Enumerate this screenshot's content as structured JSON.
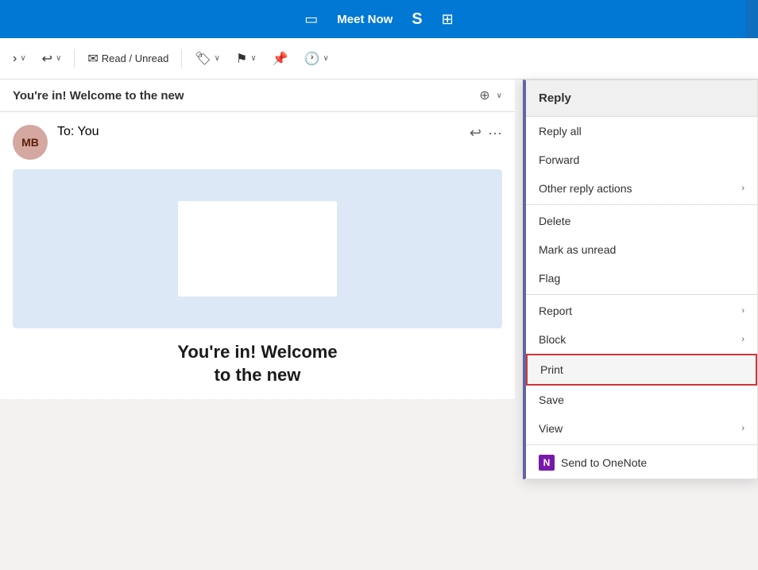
{
  "topbar": {
    "meet_now_label": "Meet Now",
    "skype_symbol": "S"
  },
  "toolbar": {
    "back_icon": "←",
    "read_unread_label": "Read / Unread",
    "tag_label": "",
    "flag_label": "",
    "pin_label": "",
    "clock_label": ""
  },
  "email_header": {
    "subject": "You're in! Welcome to the new",
    "zoom_icon": "⊕"
  },
  "email": {
    "sender_initials": "MB",
    "to_label": "To:  You",
    "reply_icon": "↩",
    "more_icon": "···",
    "headline_line1": "You're in! Welcome",
    "headline_line2": "to the new"
  },
  "dropdown": {
    "items": [
      {
        "id": "reply",
        "label": "Reply",
        "has_arrow": false,
        "highlighted": false
      },
      {
        "id": "reply-all",
        "label": "Reply all",
        "has_arrow": false,
        "highlighted": false
      },
      {
        "id": "forward",
        "label": "Forward",
        "has_arrow": false,
        "highlighted": false
      },
      {
        "id": "other-reply",
        "label": "Other reply actions",
        "has_arrow": true,
        "highlighted": false
      },
      {
        "id": "delete",
        "label": "Delete",
        "has_arrow": false,
        "highlighted": false
      },
      {
        "id": "mark-unread",
        "label": "Mark as unread",
        "has_arrow": false,
        "highlighted": false
      },
      {
        "id": "flag",
        "label": "Flag",
        "has_arrow": false,
        "highlighted": false
      },
      {
        "id": "report",
        "label": "Report",
        "has_arrow": true,
        "highlighted": false
      },
      {
        "id": "block",
        "label": "Block",
        "has_arrow": true,
        "highlighted": false
      },
      {
        "id": "print",
        "label": "Print",
        "has_arrow": false,
        "highlighted": true
      },
      {
        "id": "save",
        "label": "Save",
        "has_arrow": false,
        "highlighted": false
      },
      {
        "id": "view",
        "label": "View",
        "has_arrow": true,
        "highlighted": false
      },
      {
        "id": "send-onenote",
        "label": "Send to OneNote",
        "has_arrow": false,
        "highlighted": false,
        "has_icon": true
      }
    ]
  }
}
